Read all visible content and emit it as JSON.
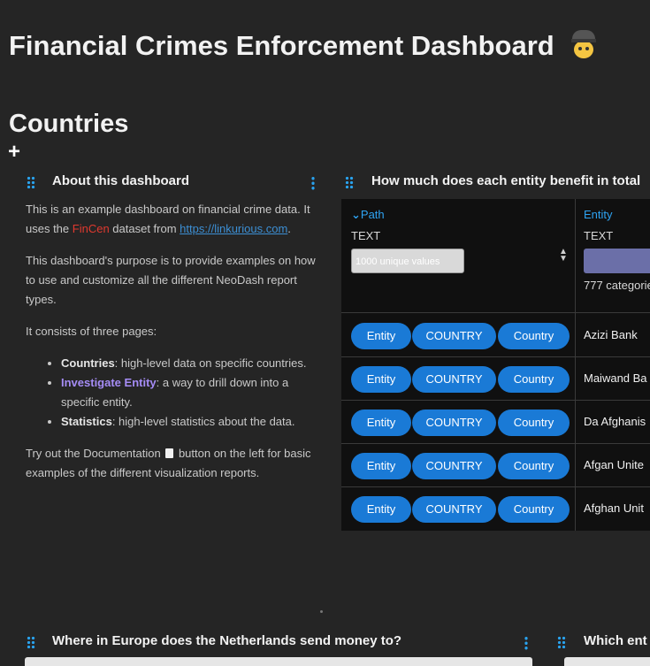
{
  "dashboard": {
    "title": "Financial Crimes Enforcement Dashboard",
    "title_icon": "detective-emoji-icon"
  },
  "page": {
    "title": "Countries",
    "add_label": "+"
  },
  "about_card": {
    "title": "About this dashboard",
    "p1_a": "This is an example dashboard on financial crime data. It uses the ",
    "p1_highlight": "FinCen",
    "p1_b": " dataset from ",
    "p1_link": "https://linkurious.com",
    "p1_c": ".",
    "p2": "This dashboard's purpose is to provide examples on how to use and customize all the different NeoDash report types.",
    "p3": "It consists of three pages:",
    "pages": [
      {
        "name": "Countries",
        "desc": ": high-level data on specific countries."
      },
      {
        "name": "Investigate Entity",
        "desc": ": a way to drill down into a specific entity."
      },
      {
        "name": "Statistics",
        "desc": ": high-level statistics about the data."
      }
    ],
    "p4_a": "Try out the Documentation ",
    "p4_b": " button on the left for basic examples of the different visualization reports."
  },
  "table_card": {
    "title": "How much does each entity benefit in total",
    "columns": [
      {
        "label": "Path",
        "type": "TEXT",
        "filter_placeholder": "1000 unique values"
      },
      {
        "label": "Entity",
        "type": "TEXT",
        "filter_note": "777 categories"
      }
    ],
    "rows": [
      {
        "chips": [
          "Entity",
          "COUNTRY",
          "Country"
        ],
        "entity": "Azizi Bank"
      },
      {
        "chips": [
          "Entity",
          "COUNTRY",
          "Country"
        ],
        "entity": "Maiwand Ba"
      },
      {
        "chips": [
          "Entity",
          "COUNTRY",
          "Country"
        ],
        "entity": "Da Afghanis"
      },
      {
        "chips": [
          "Entity",
          "COUNTRY",
          "Country"
        ],
        "entity": "Afgan Unite"
      },
      {
        "chips": [
          "Entity",
          "COUNTRY",
          "Country"
        ],
        "entity": "Afghan Unit"
      }
    ]
  },
  "bottom_cards": [
    {
      "title": "Where in Europe does the Netherlands send money to?"
    },
    {
      "title": "Which ent"
    }
  ],
  "colors": {
    "background": "#252525",
    "accent": "#29a3ef",
    "chip": "#1a7ad6",
    "highlight_red": "#e0392f",
    "link": "#3c8fd4",
    "purple": "#a58cf5"
  }
}
